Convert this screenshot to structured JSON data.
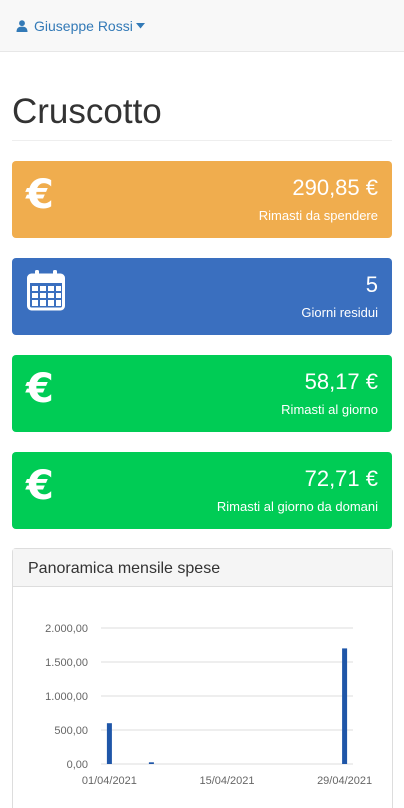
{
  "navbar": {
    "user_name": "Giuseppe Rossi",
    "user_icon": "user-icon",
    "caret_icon": "caret-down-icon"
  },
  "page": {
    "title": "Cruscotto"
  },
  "stats": [
    {
      "value": "290,85 €",
      "label": "Rimasti da spendere",
      "icon": "euro-icon",
      "color": "#f0ad4e"
    },
    {
      "value": "5",
      "label": "Giorni residui",
      "icon": "calendar-icon",
      "color": "#3a6fbf"
    },
    {
      "value": "58,17 €",
      "label": "Rimasti al giorno",
      "icon": "euro-icon",
      "color": "#00cc55"
    },
    {
      "value": "72,71 €",
      "label": "Rimasti al giorno da domani",
      "icon": "euro-icon",
      "color": "#00cc55"
    }
  ],
  "panel": {
    "title": "Panoramica mensile spese"
  },
  "chart_data": {
    "type": "bar",
    "x": [
      "01/04/2021",
      "06/04/2021",
      "29/04/2021"
    ],
    "values": [
      600,
      25,
      1700
    ],
    "xlim": [
      "31/03/2021",
      "30/04/2021"
    ],
    "x_ticks": [
      "01/04/2021",
      "15/04/2021",
      "29/04/2021"
    ],
    "y_ticks": [
      "0,00",
      "500,00",
      "1.000,00",
      "1.500,00",
      "2.000,00"
    ],
    "ylim": [
      0,
      2000
    ],
    "grid": true,
    "bar_color": "#1f56a8"
  }
}
